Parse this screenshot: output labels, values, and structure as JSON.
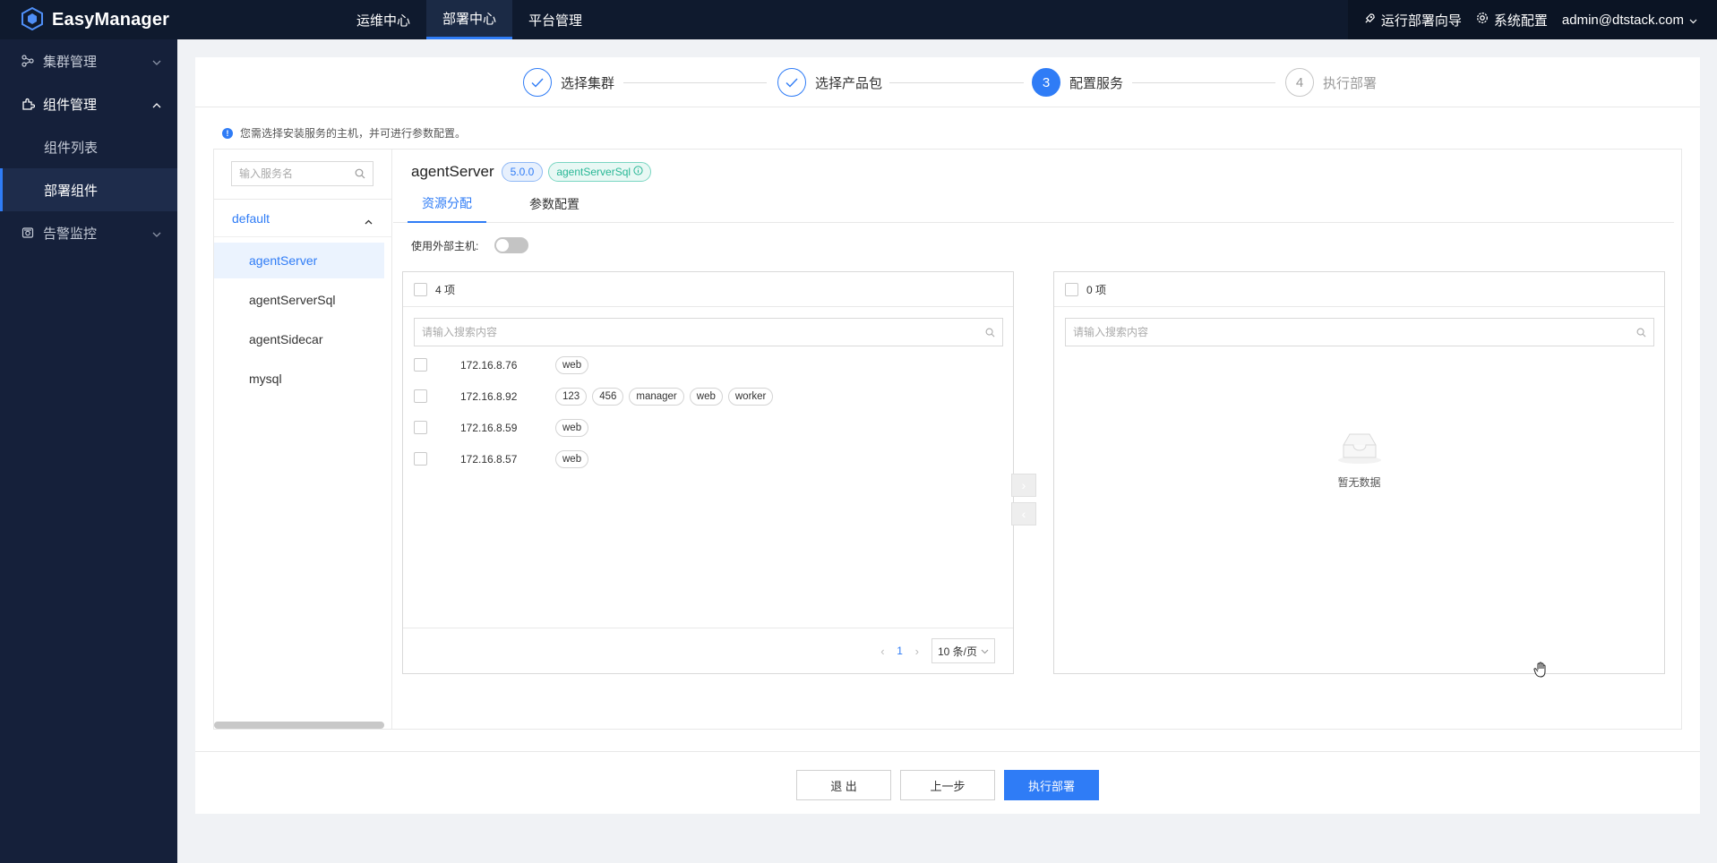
{
  "app": {
    "name": "EasyManager"
  },
  "topnav": {
    "items": [
      "运维中心",
      "部署中心",
      "平台管理"
    ],
    "active": "部署中心"
  },
  "topright": {
    "guide": "运行部署向导",
    "settings": "系统配置",
    "user": "admin@dtstack.com"
  },
  "sidebar": {
    "cluster": "集群管理",
    "component": "组件管理",
    "component_list": "组件列表",
    "deploy_component": "部署组件",
    "alert": "告警监控"
  },
  "steps": [
    {
      "label": "选择集群",
      "status": "done"
    },
    {
      "label": "选择产品包",
      "status": "done"
    },
    {
      "num": "3",
      "label": "配置服务",
      "status": "current"
    },
    {
      "num": "4",
      "label": "执行部署",
      "status": "wait"
    }
  ],
  "notice": "您需选择安装服务的主机，并可进行参数配置。",
  "services": {
    "search_placeholder": "输入服务名",
    "group": "default",
    "items": [
      "agentServer",
      "agentServerSql",
      "agentSidecar",
      "mysql"
    ],
    "active": "agentServer"
  },
  "detail": {
    "name": "agentServer",
    "version": "5.0.0",
    "dependency": "agentServerSql",
    "tabs": [
      "资源分配",
      "参数配置"
    ],
    "active_tab": "资源分配",
    "external_host_label": "使用外部主机:",
    "external_host_enabled": false
  },
  "transfer": {
    "left": {
      "count_label": "4 项",
      "search_placeholder": "请输入搜索内容",
      "hosts": [
        {
          "ip": "172.16.8.76",
          "tags": [
            "web"
          ]
        },
        {
          "ip": "172.16.8.92",
          "tags": [
            "123",
            "456",
            "manager",
            "web",
            "worker"
          ]
        },
        {
          "ip": "172.16.8.59",
          "tags": [
            "web"
          ]
        },
        {
          "ip": "172.16.8.57",
          "tags": [
            "web"
          ]
        }
      ],
      "page": "1",
      "page_size": "10 条/页"
    },
    "right": {
      "count_label": "0 项",
      "search_placeholder": "请输入搜索内容",
      "empty_text": "暂无数据"
    }
  },
  "actions": {
    "exit": "退 出",
    "prev": "上一步",
    "execute": "执行部署"
  },
  "colors": {
    "primary": "#2f7cf6",
    "topbar": "#0f1a2e",
    "sidebar": "#15203a",
    "success_tag": "#29b796"
  }
}
